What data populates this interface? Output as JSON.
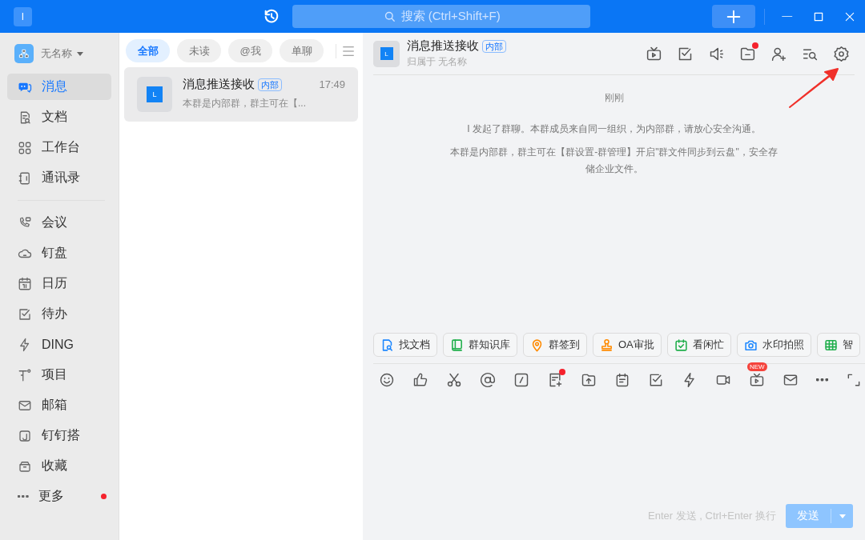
{
  "titlebar": {
    "avatar": "I",
    "search": {
      "placeholder": "搜索 (Ctrl+Shift+F)"
    }
  },
  "sidebar": {
    "workspace": "无名称",
    "sections": [
      {
        "items": [
          {
            "label": "消息",
            "selected": true,
            "dot": false
          },
          {
            "label": "文档",
            "selected": false,
            "dot": false
          },
          {
            "label": "工作台",
            "selected": false,
            "dot": false
          },
          {
            "label": "通讯录",
            "selected": false,
            "dot": false
          }
        ]
      },
      {
        "items": [
          {
            "label": "会议",
            "selected": false,
            "dot": false
          },
          {
            "label": "钉盘",
            "selected": false,
            "dot": false
          },
          {
            "label": "日历",
            "selected": false,
            "dot": false
          },
          {
            "label": "待办",
            "selected": false,
            "dot": false
          },
          {
            "label": "DING",
            "selected": false,
            "dot": false
          },
          {
            "label": "项目",
            "selected": false,
            "dot": false
          },
          {
            "label": "邮箱",
            "selected": false,
            "dot": false
          },
          {
            "label": "钉钉搭",
            "selected": false,
            "dot": false
          },
          {
            "label": "收藏",
            "selected": false,
            "dot": false
          },
          {
            "label": "更多",
            "selected": false,
            "dot": true
          }
        ]
      }
    ]
  },
  "conversation_list": {
    "filters": [
      {
        "label": "全部",
        "selected": true
      },
      {
        "label": "未读",
        "selected": false
      },
      {
        "label": "@我",
        "selected": false
      },
      {
        "label": "单聊",
        "selected": false
      }
    ],
    "items": [
      {
        "avatar": "L",
        "title": "消息推送接收",
        "tag": "内部",
        "time": "17:49",
        "preview": "本群是内部群，群主可在【...",
        "selected": true
      }
    ]
  },
  "chat": {
    "avatar": "L",
    "title": "消息推送接收",
    "tag": "内部",
    "subtitle": "归属于 无名称",
    "header_tools": [
      {
        "dot": false
      },
      {
        "dot": false
      },
      {
        "dot": false
      },
      {
        "dot": true
      },
      {
        "dot": false
      },
      {
        "dot": false
      },
      {
        "dot": false
      }
    ],
    "messages": [
      {
        "kind": "time",
        "text": "刚刚"
      },
      {
        "kind": "system",
        "text": "I 发起了群聊。本群成员来自同一组织，为内部群，请放心安全沟通。"
      },
      {
        "kind": "system",
        "text": "本群是内部群，群主可在【群设置-群管理】开启\"群文件同步到云盘\"，安全存储企业文件。"
      }
    ],
    "quick_actions": [
      {
        "label": "找文档",
        "color": "#1e88ff"
      },
      {
        "label": "群知识库",
        "color": "#1fae4b"
      },
      {
        "label": "群签到",
        "color": "#ff8a00"
      },
      {
        "label": "OA审批",
        "color": "#ff8a00"
      },
      {
        "label": "看闲忙",
        "color": "#1fae4b"
      },
      {
        "label": "水印拍照",
        "color": "#1e88ff"
      },
      {
        "label": "智",
        "color": "#1fae4b"
      }
    ],
    "composer": {
      "tools": [
        {
          "dot": false
        },
        {
          "dot": false
        },
        {
          "dot": false
        },
        {
          "dot": false
        },
        {
          "dot": false
        },
        {
          "dot": true
        },
        {
          "dot": false
        },
        {
          "dot": false
        },
        {
          "dot": false
        },
        {
          "dot": false
        },
        {
          "dot": false
        },
        {
          "dot": false,
          "badge": "NEW"
        },
        {
          "dot": false
        },
        {
          "dot": false
        },
        {
          "dot": false
        }
      ],
      "hint": "Enter 发送 , Ctrl+Enter 换行",
      "send_button": {
        "label": "发送",
        "disabled": true
      }
    }
  }
}
